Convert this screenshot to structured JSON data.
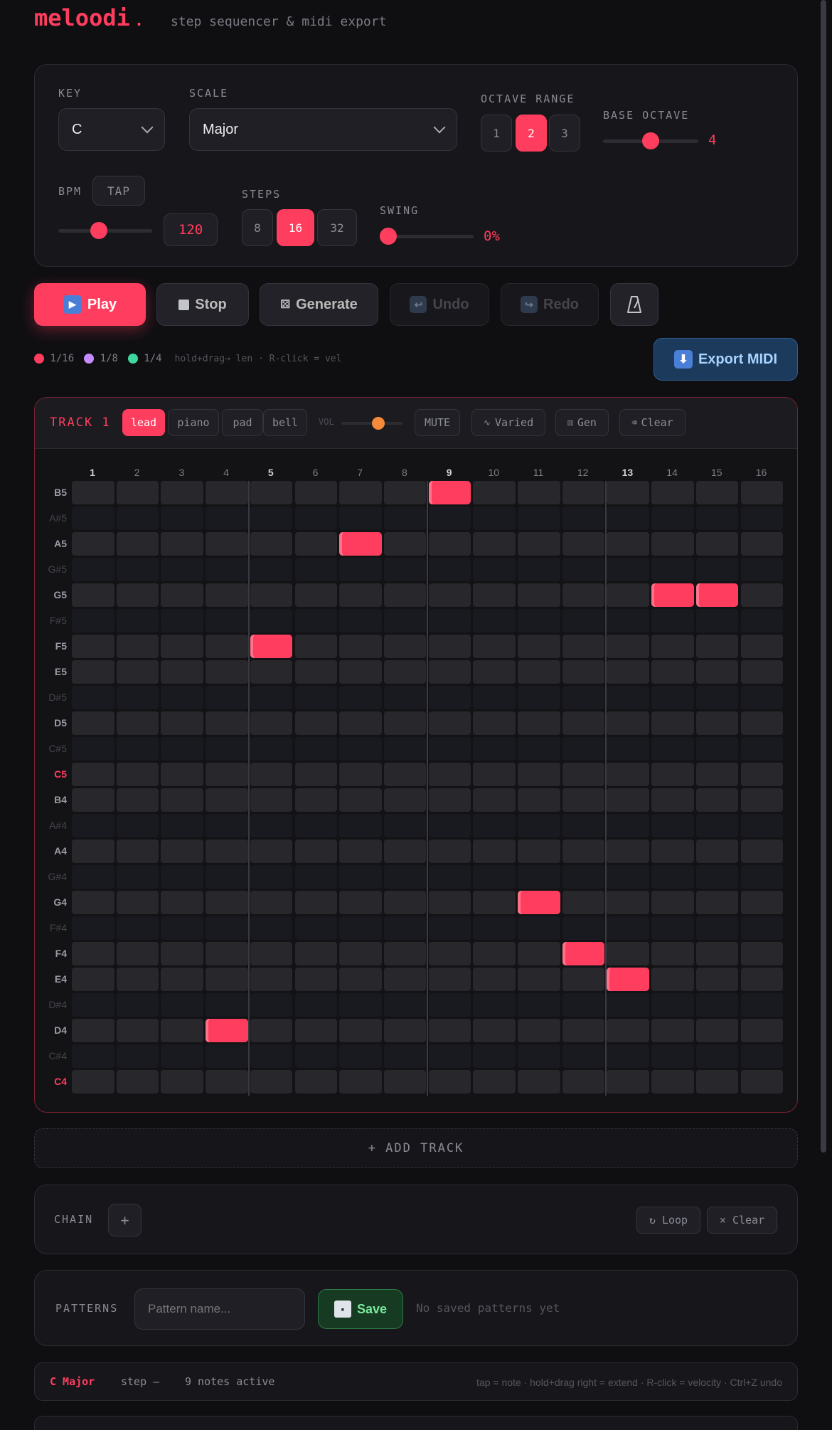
{
  "app": {
    "name": "meloodi",
    "dot": ".",
    "tagline": "step sequencer & midi export"
  },
  "settings": {
    "key_label": "KEY",
    "key_value": "C",
    "scale_label": "SCALE",
    "scale_value": "Major",
    "octave_range_label": "OCTAVE RANGE",
    "octave_range_options": [
      "1",
      "2",
      "3"
    ],
    "octave_range_selected": "2",
    "base_octave_label": "BASE OCTAVE",
    "base_octave_value": "4",
    "base_octave_level": 0.5,
    "bpm_label": "BPM",
    "tap_label": "TAP",
    "bpm_value": "120",
    "bpm_level": 0.42,
    "steps_label": "STEPS",
    "steps_options": [
      "8",
      "16",
      "32"
    ],
    "steps_selected": "16",
    "swing_label": "SWING",
    "swing_value": "0%",
    "swing_level": 0
  },
  "transport": {
    "play_label": "Play",
    "play_icon": "play-icon",
    "stop_label": "Stop",
    "stop_icon": "stop-square-icon",
    "generate_label": "Generate",
    "generate_icon": "dice-icon",
    "undo_label": "Undo",
    "undo_icon": "undo-arrow-icon",
    "redo_label": "Redo",
    "redo_icon": "redo-arrow-icon",
    "metronome_icon": "metronome-icon",
    "export_label": "Export MIDI",
    "export_icon": "download-arrow-icon"
  },
  "legend": {
    "items": [
      {
        "label": "1/16",
        "color": "#ff3d5e"
      },
      {
        "label": "1/8",
        "color": "#c38bff"
      },
      {
        "label": "1/4",
        "color": "#3fd6a0"
      }
    ],
    "hint": "hold+drag→ len · R-click = vel"
  },
  "track": {
    "title": "TRACK 1",
    "instruments": [
      "lead",
      "piano",
      "pad",
      "bell"
    ],
    "selected_instrument": "lead",
    "vol_label": "VOL",
    "volume_level": 0.63,
    "mute_label": "MUTE",
    "varied_label": "Varied",
    "gen_label": "Gen",
    "clear_label": "Clear",
    "columns": [
      "1",
      "2",
      "3",
      "4",
      "5",
      "6",
      "7",
      "8",
      "9",
      "10",
      "11",
      "12",
      "13",
      "14",
      "15",
      "16"
    ],
    "rows": [
      "B5",
      "A#5",
      "A5",
      "G#5",
      "G5",
      "F#5",
      "F5",
      "E5",
      "D#5",
      "D5",
      "C#5",
      "C5",
      "B4",
      "A#4",
      "A4",
      "G#4",
      "G4",
      "F#4",
      "F4",
      "E4",
      "D#4",
      "D4",
      "C#4",
      "C4"
    ],
    "notes": [
      {
        "pitch": "B5",
        "step": 9
      },
      {
        "pitch": "A5",
        "step": 7
      },
      {
        "pitch": "G5",
        "step": 14
      },
      {
        "pitch": "G5",
        "step": 15
      },
      {
        "pitch": "F5",
        "step": 5
      },
      {
        "pitch": "G4",
        "step": 11
      },
      {
        "pitch": "F4",
        "step": 12
      },
      {
        "pitch": "E4",
        "step": 13
      },
      {
        "pitch": "D4",
        "step": 4
      }
    ],
    "accent_color": "#ff3d5e"
  },
  "add_track_label": "+ ADD TRACK",
  "chain": {
    "label": "CHAIN",
    "add_label": "+",
    "loop_label": "↻ Loop",
    "clear_label": "× Clear"
  },
  "patterns": {
    "label": "PATTERNS",
    "placeholder": "Pattern name...",
    "save_label": "Save",
    "save_icon": "floppy-disk-icon",
    "empty_text": "No saved patterns yet"
  },
  "status": {
    "key_scale": "C Major",
    "step_text": "step —",
    "notes_text": "9 notes active",
    "help": "tap = note · hold+drag right = extend · R-click = velocity · Ctrl+Z undo"
  }
}
